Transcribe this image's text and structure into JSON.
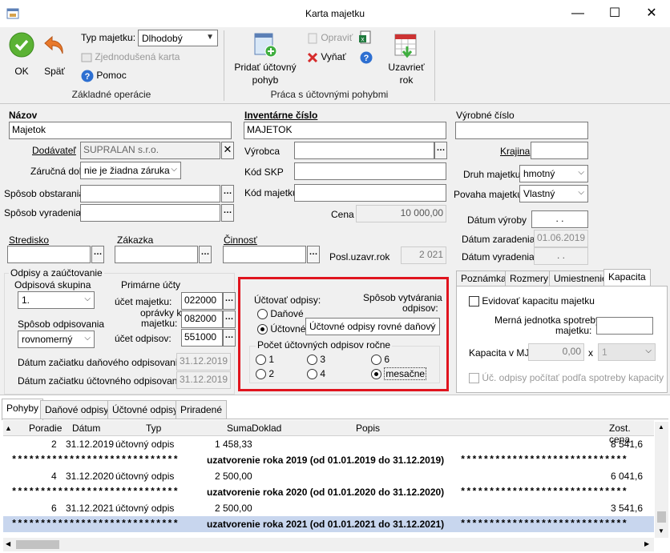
{
  "window": {
    "title": "Karta majetku",
    "minimize": "—",
    "maximize": "☐",
    "close": "✕"
  },
  "ribbon": {
    "ok": "OK",
    "back": "Späť",
    "asset_type_label": "Typ majetku:",
    "asset_type_value": "Dlhodobý",
    "simplified_card": "Zjednodušená karta",
    "help": "Pomoc",
    "group1": "Základné operácie",
    "add_movement_line1": "Pridať účtovný",
    "add_movement_line2": "pohyb",
    "edit": "Opraviť",
    "remove": "Vyňať",
    "close_year_line1": "Uzavrieť",
    "close_year_line2": "rok",
    "group2": "Práca s účtovnými pohybmi"
  },
  "form": {
    "name_label": "Názov",
    "name_value": "Majetok",
    "inventory_label": "Inventárne číslo",
    "inventory_value": "MAJETOK",
    "serial_label": "Výrobné číslo",
    "serial_value": "",
    "supplier_label": "Dodávateľ",
    "supplier_value": "SUPRALAN s.r.o.",
    "warranty_label": "Záručná doba",
    "warranty_value": "nie je žiadna záruka",
    "acquisition_label": "Spôsob obstarania",
    "disposal_label": "Spôsob vyradenia",
    "manufacturer_label": "Výrobca",
    "skp_label": "Kód SKP",
    "asset_code_label": "Kód majetku",
    "price_label": "Cena",
    "price_value": "10 000,00",
    "country_label": "Krajina",
    "asset_kind_label": "Druh majetku",
    "asset_kind_value": "hmotný",
    "asset_nature_label": "Povaha majetku",
    "asset_nature_value": "Vlastný",
    "manufacture_date_label": "Dátum výroby",
    "manufacture_date_value": ".   .",
    "entry_date_label": "Dátum zaradenia",
    "entry_date_value": "01.06.2019",
    "retire_date_label": "Dátum vyradenia",
    "retire_date_value": ".   .",
    "center_label": "Stredisko",
    "order_label": "Zákazka",
    "activity_label": "Činnosť",
    "last_closed_label": "Posl.uzavr.rok",
    "last_closed_value": "2 021"
  },
  "depreciation": {
    "group_title": "Odpisy a zaúčtovanie",
    "group_label": "Odpisová skupina",
    "group_value": "1.",
    "method_label": "Spôsob odpisovania",
    "method_value": "rovnomerný",
    "primary_accounts": "Primárne účty",
    "asset_account_label": "účet majetku:",
    "asset_account_value": "022000",
    "adjust_label_1": "oprávky k",
    "adjust_label_2": "majetku:",
    "adjust_value": "082000",
    "depr_account_label": "účet odpisov:",
    "depr_account_value": "551000",
    "tax_start_label": "Dátum začiatku daňového odpisovania:",
    "tax_start_value": "31.12.2019",
    "acc_start_label": "Dátum začiatku účtovného odpisovania:",
    "acc_start_value": "31.12.2019",
    "post_label": "Účtovať odpisy:",
    "post_tax": "Daňové",
    "post_acc": "Účtovné",
    "creation_label_1": "Spôsob vytvárania",
    "creation_label_2": "odpisov:",
    "creation_value": "Účtovné odpisy rovné daňový",
    "count_label": "Počet účtovných odpisov ročne",
    "count_opts": [
      "1",
      "3",
      "6",
      "2",
      "4",
      "mesačne"
    ]
  },
  "side_tabs": [
    "Poznámka",
    "Rozmery",
    "Umiestnenie",
    "Kapacita"
  ],
  "capacity": {
    "track_label": "Evidovať kapacitu majetku",
    "unit_label_1": "Merná jednotka spotreby",
    "unit_label_2": "majetku:",
    "capacity_label": "Kapacita v MJ:",
    "capacity_value": "0,00",
    "x": "x",
    "multiplier_value": "1",
    "consumption_label": "Úč. odpisy počítať podľa spotreby kapacity"
  },
  "grid": {
    "tabs": [
      "Pohyby",
      "Daňové odpisy",
      "Účtovné odpisy",
      "Priradené"
    ],
    "columns": [
      "Poradie",
      "Dátum",
      "Typ",
      "Suma",
      "Doklad",
      "Popis",
      "Zost. cena"
    ],
    "rows": [
      {
        "order": "2",
        "date": "31.12.2019",
        "type": "účtovný odpis",
        "amount": "1 458,33",
        "rest": "8 541,6"
      },
      {
        "stars_left": "*****************************",
        "text": "uzatvorenie roka 2019 (od 01.01.2019 do 31.12.2019)",
        "stars_right": "*****************************"
      },
      {
        "order": "4",
        "date": "31.12.2020",
        "type": "účtovný odpis",
        "amount": "2 500,00",
        "rest": "6 041,6"
      },
      {
        "stars_left": "*****************************",
        "text": "uzatvorenie roka 2020 (od 01.01.2020 do 31.12.2020)",
        "stars_right": "*****************************"
      },
      {
        "order": "6",
        "date": "31.12.2021",
        "type": "účtovný odpis",
        "amount": "2 500,00",
        "rest": "3 541,6"
      },
      {
        "stars_left": "*****************************",
        "text": "uzatvorenie roka 2021 (od 01.01.2021 do 31.12.2021)",
        "stars_right": "*****************************"
      }
    ]
  },
  "colors": {
    "highlight": "#e0141e",
    "selected_row": "#c8d6ee",
    "ok_green": "#5bb234"
  }
}
